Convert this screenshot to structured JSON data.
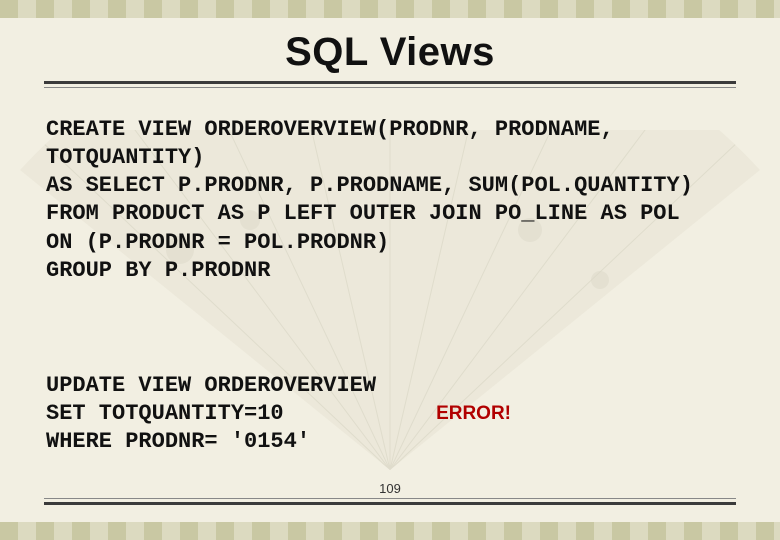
{
  "title": "SQL Views",
  "code1": "CREATE VIEW ORDEROVERVIEW(PRODNR, PRODNAME,\nTOTQUANTITY)\nAS SELECT P.PRODNR, P.PRODNAME, SUM(POL.QUANTITY)\nFROM PRODUCT AS P LEFT OUTER JOIN PO_LINE AS POL\nON (P.PRODNR = POL.PRODNR)\nGROUP BY P.PRODNR",
  "code2": "UPDATE VIEW ORDEROVERVIEW\nSET TOTQUANTITY=10\nWHERE PRODNR= '0154'",
  "error_label": "ERROR!",
  "page_number": "109"
}
